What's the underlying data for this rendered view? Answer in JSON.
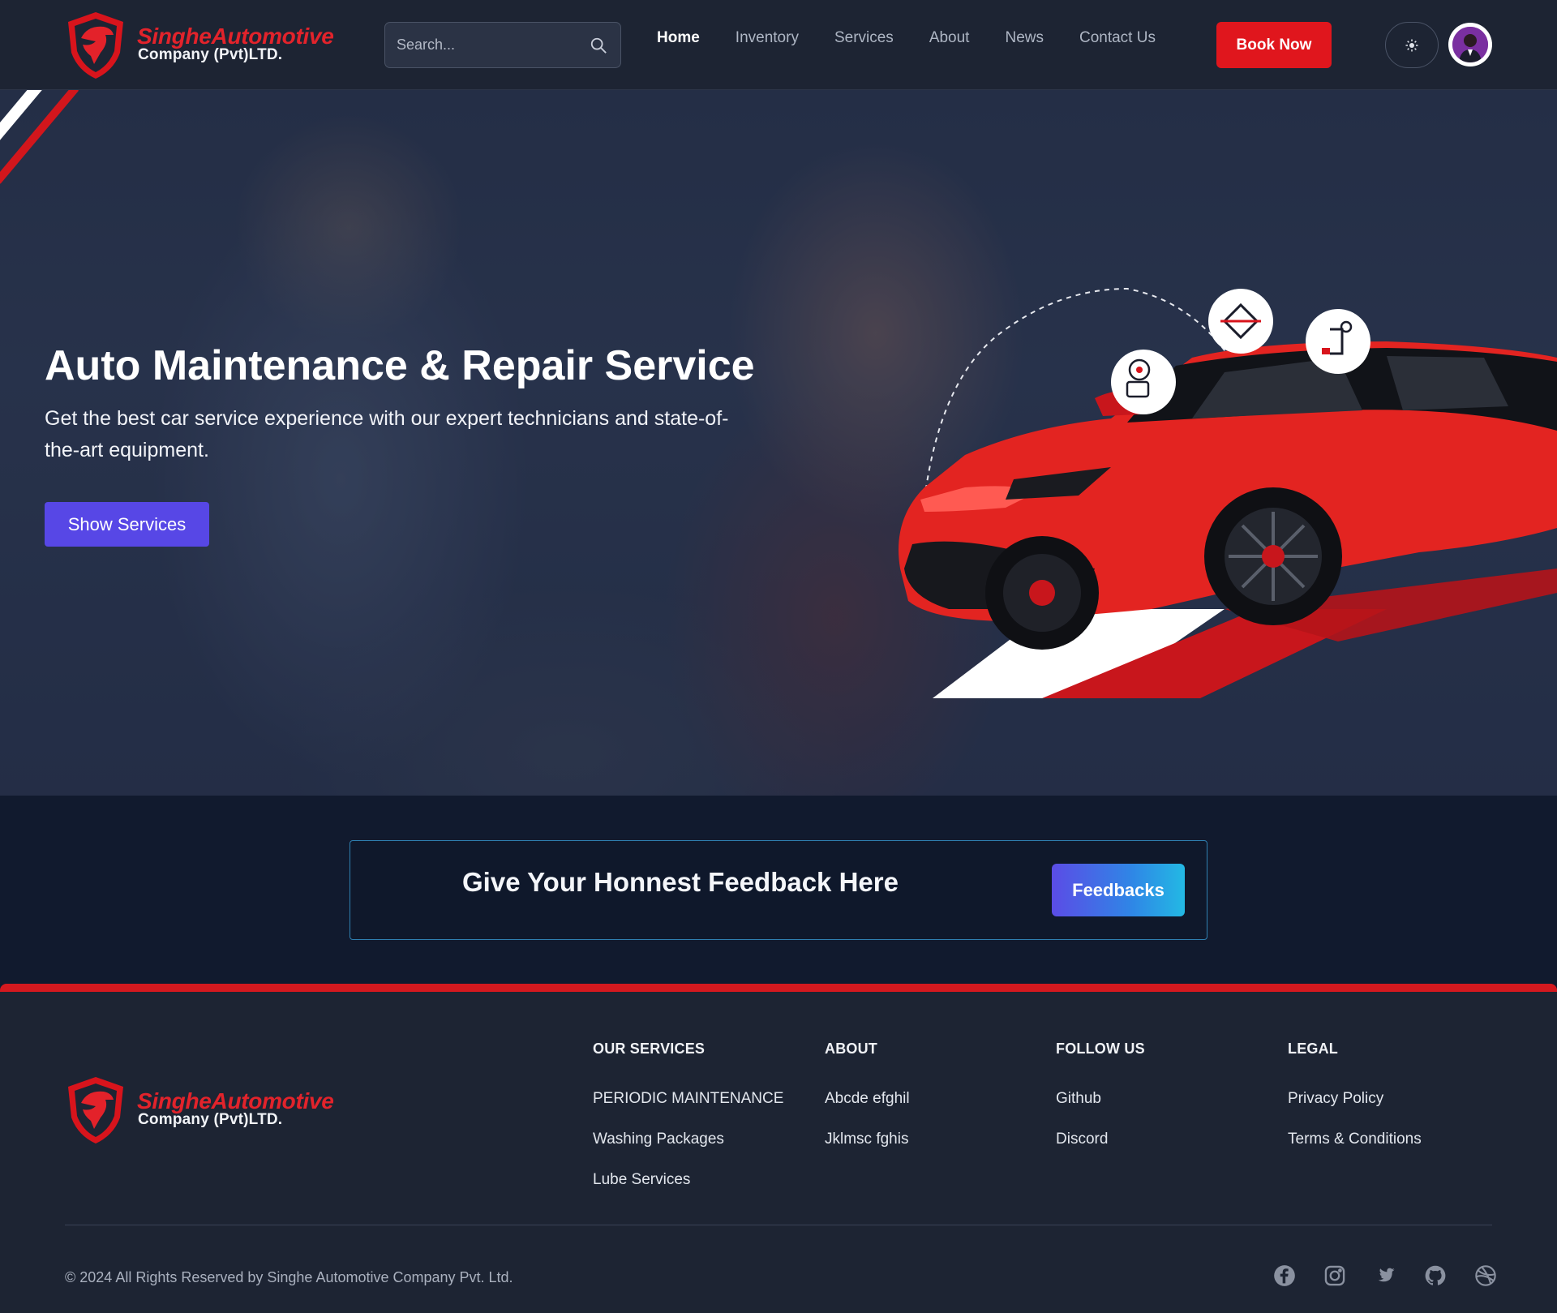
{
  "header": {
    "brand": {
      "name": "SingheAutomotive",
      "subtitle": "Company (Pvt)LTD."
    },
    "search": {
      "placeholder": "Search..."
    },
    "nav": [
      {
        "label": "Home",
        "active": true
      },
      {
        "label": "Inventory",
        "active": false
      },
      {
        "label": "Services",
        "active": false
      },
      {
        "label": "About",
        "active": false
      },
      {
        "label": "News",
        "active": false
      },
      {
        "label": "Contact Us",
        "active": false
      }
    ],
    "book_label": "Book Now",
    "theme_icon": "sun-icon",
    "avatar_icon": "user-avatar"
  },
  "hero": {
    "title": "Auto Maintenance & Repair Service",
    "subtitle": "Get the best car service experience with our expert technicians and state-of-the-art equipment.",
    "button_label": "Show Services",
    "badge_icons": [
      "mechanic-icon",
      "car-jack-icon",
      "repair-tools-icon"
    ]
  },
  "feedback": {
    "title": "Give Your Honnest Feedback Here",
    "button_label": "Feedbacks"
  },
  "footer": {
    "brand": {
      "name": "SingheAutomotive",
      "subtitle": "Company (Pvt)LTD."
    },
    "columns": [
      {
        "heading": "OUR SERVICES",
        "links": [
          "PERIODIC MAINTENANCE",
          "Washing Packages",
          "Lube Services"
        ]
      },
      {
        "heading": "ABOUT",
        "links": [
          "Abcde efghil",
          "Jklmsc fghis"
        ]
      },
      {
        "heading": "FOLLOW US",
        "links": [
          "Github",
          "Discord"
        ]
      },
      {
        "heading": "LEGAL",
        "links": [
          "Privacy Policy",
          "Terms & Conditions"
        ]
      }
    ],
    "copyright": "© 2024 All Rights Reserved by Singhe Automotive Company Pvt. Ltd.",
    "socials": [
      "facebook-icon",
      "instagram-icon",
      "twitter-icon",
      "github-icon",
      "dribbble-icon"
    ]
  },
  "colors": {
    "accent_red": "#e0161d",
    "primary_purple": "#5747e6",
    "header_bg": "#1d2433",
    "page_bg": "#111a2e"
  }
}
